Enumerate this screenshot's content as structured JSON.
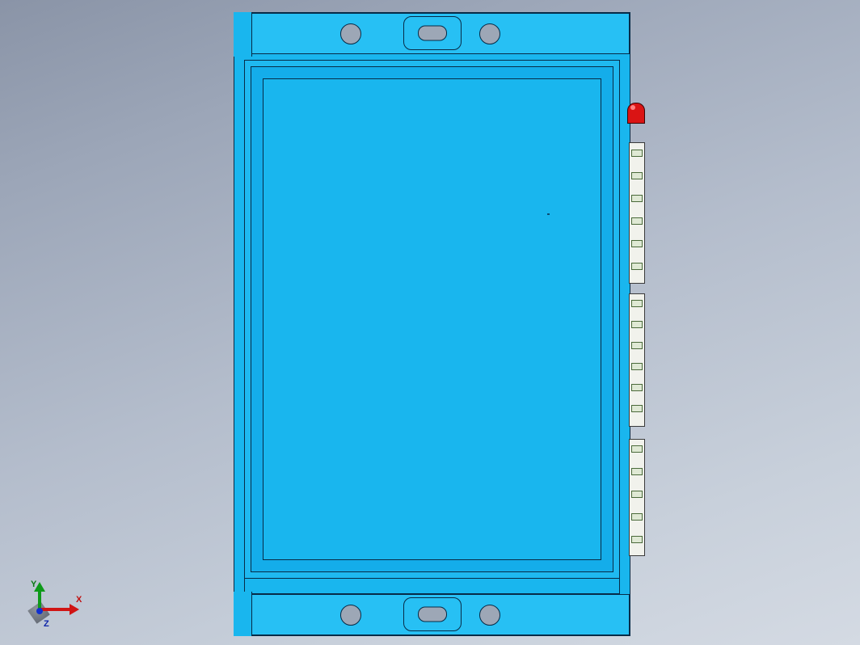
{
  "triad": {
    "x_label": "X",
    "y_label": "Y",
    "z_label": "Z"
  },
  "model": {
    "body_color": "#19b6ee",
    "face_color": "#27c0f4",
    "hole_color": "#9da7b6",
    "led_color": "#da1414",
    "connector_color": "#f1f2ec"
  },
  "connectors": {
    "rail_a_pins": 6,
    "rail_b_pins": 6,
    "rail_c_pins": 5
  }
}
